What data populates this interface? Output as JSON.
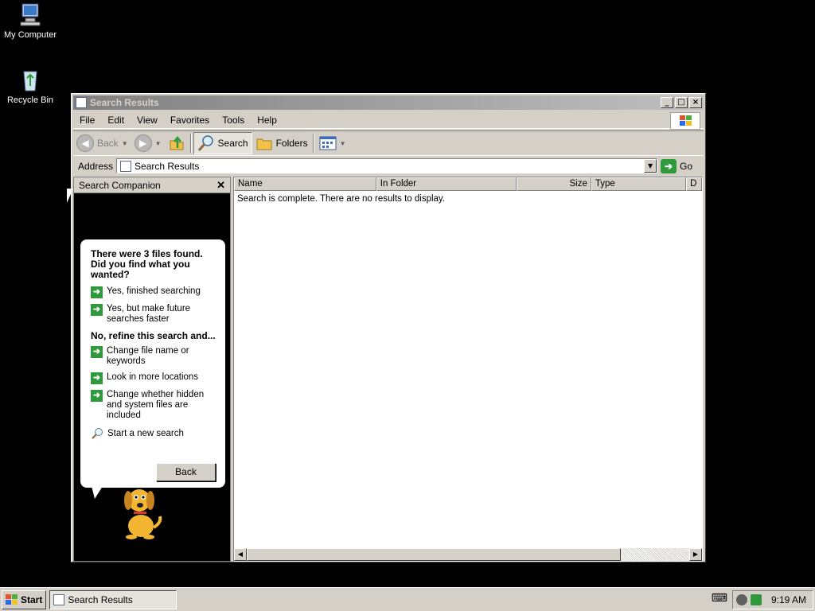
{
  "desktop": {
    "icons": [
      {
        "label": "My Computer",
        "icon": "computer-icon"
      },
      {
        "label": "Recycle Bin",
        "icon": "recycle-bin-icon"
      }
    ]
  },
  "window": {
    "title": "Search Results",
    "controls": {
      "minimize": "_",
      "maximize": "□",
      "close": "×"
    },
    "menu": [
      "File",
      "Edit",
      "View",
      "Favorites",
      "Tools",
      "Help"
    ],
    "toolbar": {
      "back": "Back",
      "search": "Search",
      "folders": "Folders"
    },
    "address": {
      "label": "Address",
      "value": "Search Results",
      "go": "Go"
    }
  },
  "companion": {
    "title": "Search Companion",
    "question": "There were 3 files found. Did you find what you wanted?",
    "options": [
      "Yes, finished searching",
      "Yes, but make future searches faster"
    ],
    "refine_heading": "No, refine this search and...",
    "refine_options": [
      "Change file name or keywords",
      "Look in more locations",
      "Change whether hidden and system files are included"
    ],
    "new_search": "Start a new search",
    "back_button": "Back"
  },
  "results": {
    "columns": [
      "Name",
      "In Folder",
      "Size",
      "Type",
      "D"
    ],
    "message": "Search is complete. There are no results to display."
  },
  "taskbar": {
    "start": "Start",
    "task": "Search Results",
    "clock": "9:19 AM"
  }
}
